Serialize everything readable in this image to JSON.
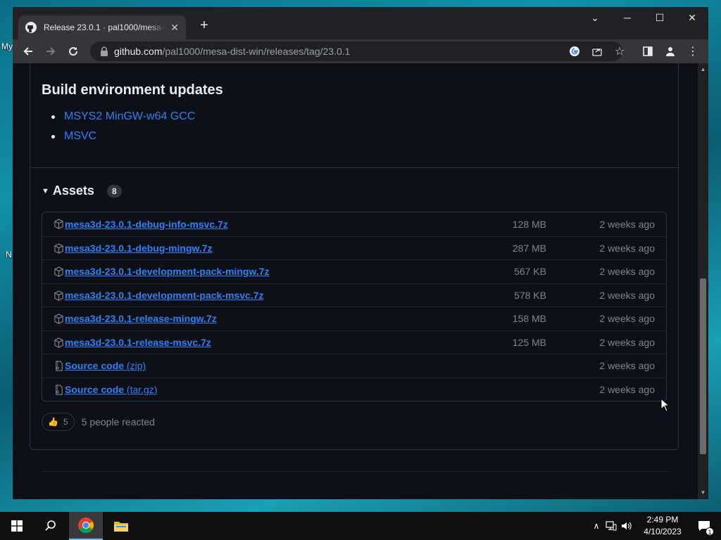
{
  "desktop": {
    "fragments": [
      "My",
      "N"
    ]
  },
  "browser": {
    "tab_title": "Release 23.0.1 · pal1000/mesa-dist-win",
    "url_host": "github.com",
    "url_path": "/pal1000/mesa-dist-win/releases/tag/23.0.1"
  },
  "release": {
    "build_heading": "Build environment updates",
    "build_items": [
      "MSYS2 MinGW-w64 GCC",
      "MSVC"
    ],
    "assets_label": "Assets",
    "assets_count": "8",
    "assets": [
      {
        "name": "mesa3d-23.0.1-debug-info-msvc.7z",
        "size": "128 MB",
        "time": "2 weeks ago",
        "icon": "package-icon"
      },
      {
        "name": "mesa3d-23.0.1-debug-mingw.7z",
        "size": "287 MB",
        "time": "2 weeks ago",
        "icon": "package-icon"
      },
      {
        "name": "mesa3d-23.0.1-development-pack-mingw.7z",
        "size": "567 KB",
        "time": "2 weeks ago",
        "icon": "package-icon"
      },
      {
        "name": "mesa3d-23.0.1-development-pack-msvc.7z",
        "size": "578 KB",
        "time": "2 weeks ago",
        "icon": "package-icon"
      },
      {
        "name": "mesa3d-23.0.1-release-mingw.7z",
        "size": "158 MB",
        "time": "2 weeks ago",
        "icon": "package-icon"
      },
      {
        "name": "mesa3d-23.0.1-release-msvc.7z",
        "size": "125 MB",
        "time": "2 weeks ago",
        "icon": "package-icon"
      }
    ],
    "source": [
      {
        "name": "Source code",
        "paren": "(zip)",
        "time": "2 weeks ago",
        "icon": "file-zip-icon"
      },
      {
        "name": "Source code",
        "paren": "(tar.gz)",
        "time": "2 weeks ago",
        "icon": "file-zip-icon"
      }
    ],
    "reaction_count": "5",
    "reaction_text": "5 people reacted"
  },
  "taskbar": {
    "time": "2:49 PM",
    "date": "4/10/2023",
    "notification_count": "1"
  },
  "colors": {
    "link": "#2f81f7",
    "page_bg": "#0d1117",
    "muted": "#7d8590",
    "border": "#30363d"
  }
}
